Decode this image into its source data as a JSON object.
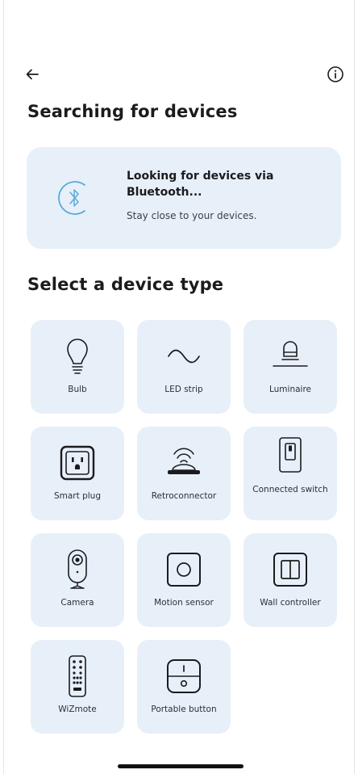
{
  "header": {
    "back_icon": "arrow-left-icon",
    "info_icon": "info-circle-icon"
  },
  "title": "Searching for devices",
  "search_card": {
    "icon": "bluetooth-icon",
    "title": "Looking for devices via Bluetooth...",
    "subtitle": "Stay close to your devices."
  },
  "device_section": {
    "title": "Select a device type",
    "devices": [
      {
        "label": "Bulb",
        "icon": "bulb-icon"
      },
      {
        "label": "LED strip",
        "icon": "led-strip-icon"
      },
      {
        "label": "Luminaire",
        "icon": "luminaire-icon"
      },
      {
        "label": "Smart plug",
        "icon": "smart-plug-icon"
      },
      {
        "label": "Retroconnector",
        "icon": "retroconnector-icon"
      },
      {
        "label": "Connected switch",
        "icon": "connected-switch-icon"
      },
      {
        "label": "Camera",
        "icon": "camera-icon"
      },
      {
        "label": "Motion sensor",
        "icon": "motion-sensor-icon"
      },
      {
        "label": "Wall controller",
        "icon": "wall-controller-icon"
      },
      {
        "label": "WiZmote",
        "icon": "wizmote-icon"
      },
      {
        "label": "Portable button",
        "icon": "portable-button-icon"
      }
    ]
  },
  "colors": {
    "card_bg": "#e7f0f9",
    "bluetooth_accent": "#5aa9dd",
    "text": "#1b1b1f"
  }
}
